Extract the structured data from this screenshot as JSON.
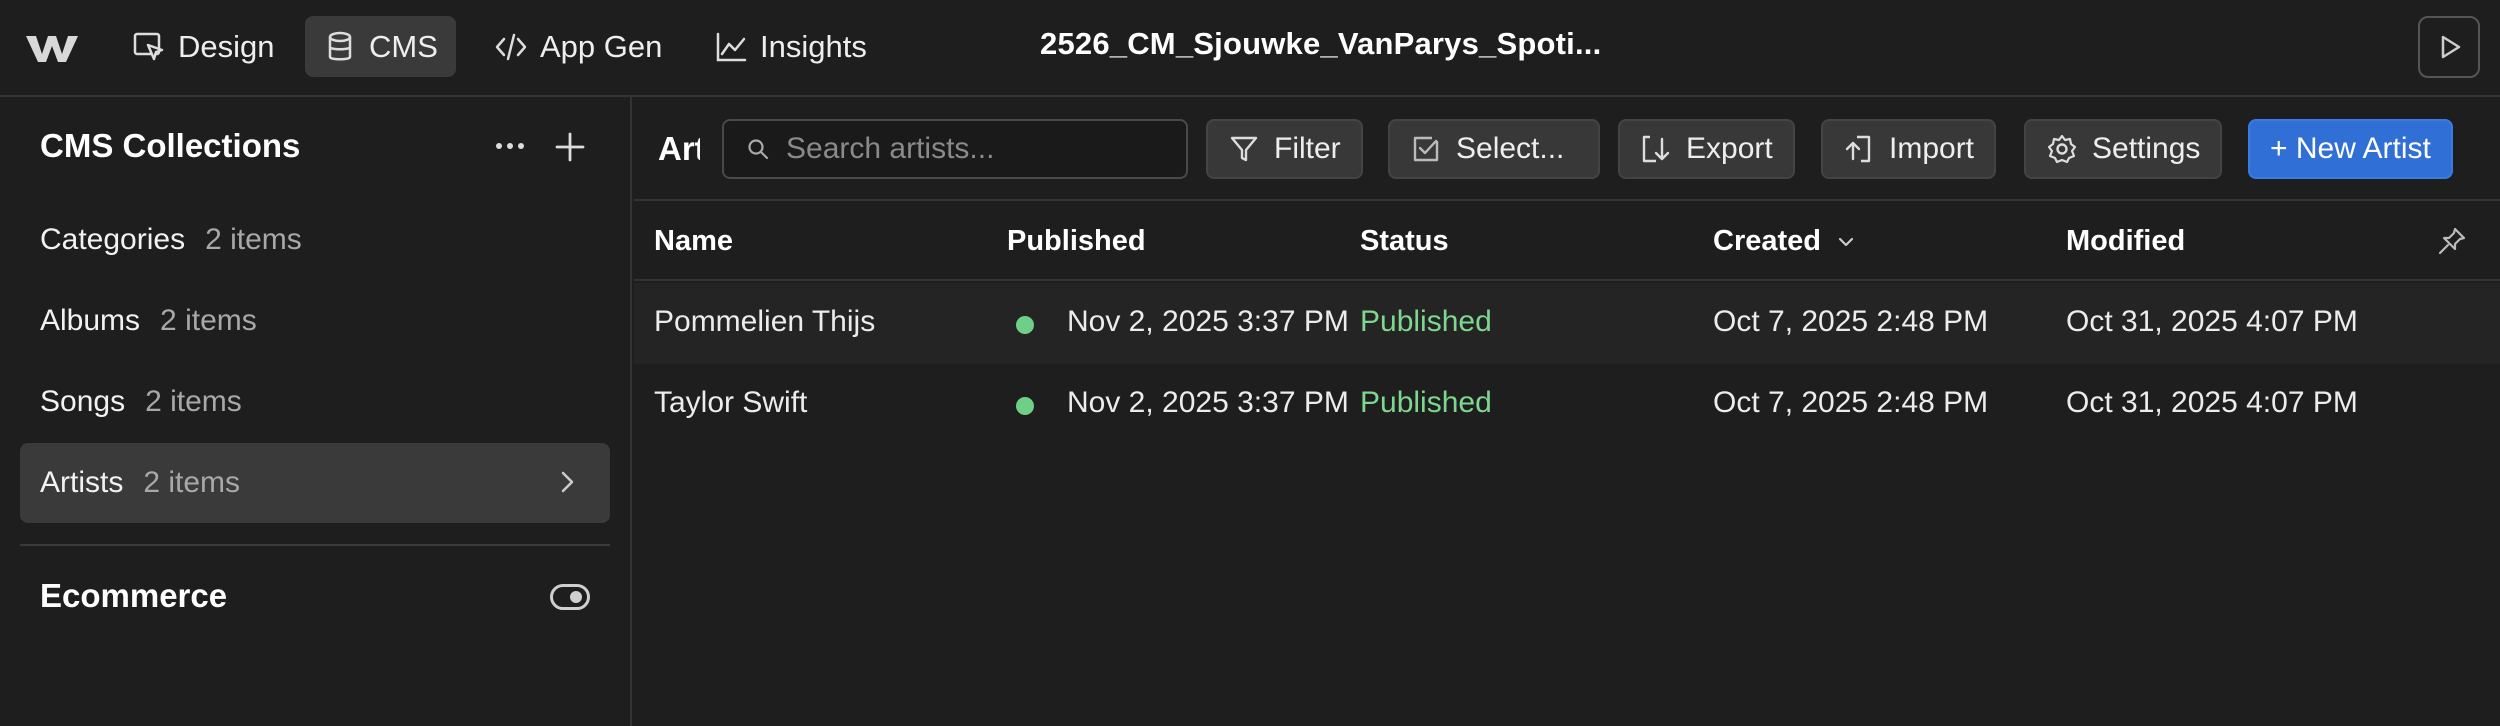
{
  "topbar": {
    "nav": [
      {
        "label": "Design",
        "icon": "cursor-select-icon"
      },
      {
        "label": "CMS",
        "icon": "database-icon"
      },
      {
        "label": "App Gen",
        "icon": "code-icon"
      },
      {
        "label": "Insights",
        "icon": "chart-line-icon"
      }
    ],
    "active_nav": "CMS",
    "project_title": "2526_CM_Sjouwke_VanParys_Spoti..."
  },
  "sidebar": {
    "heading": "CMS Collections",
    "collections": [
      {
        "label": "Categories",
        "count": "2 items"
      },
      {
        "label": "Albums",
        "count": "2 items"
      },
      {
        "label": "Songs",
        "count": "2 items"
      },
      {
        "label": "Artists",
        "count": "2 items"
      }
    ],
    "active_collection": "Artists",
    "ecommerce_label": "Ecommerce"
  },
  "toolbar": {
    "collection_name": "Artists",
    "search_placeholder": "Search artists...",
    "filter_label": "Filter",
    "select_label": "Select...",
    "export_label": "Export",
    "import_label": "Import",
    "settings_label": "Settings",
    "new_label": "+ New Artist"
  },
  "table": {
    "columns": [
      "Name",
      "Published",
      "Status",
      "Created",
      "Modified"
    ],
    "sorted_column": "Created",
    "rows": [
      {
        "name": "Pommelien Thijs",
        "published": "Nov 2, 2025 3:37 PM",
        "status": "Published",
        "created": "Oct 7, 2025 2:48 PM",
        "modified": "Oct 31, 2025 4:07 PM"
      },
      {
        "name": "Taylor Swift",
        "published": "Nov 2, 2025 3:37 PM",
        "status": "Published",
        "created": "Oct 7, 2025 2:48 PM",
        "modified": "Oct 31, 2025 4:07 PM"
      }
    ]
  },
  "colors": {
    "accent": "#2f6fd6",
    "published_status": "#7fd68f",
    "background": "#1e1e1e"
  }
}
